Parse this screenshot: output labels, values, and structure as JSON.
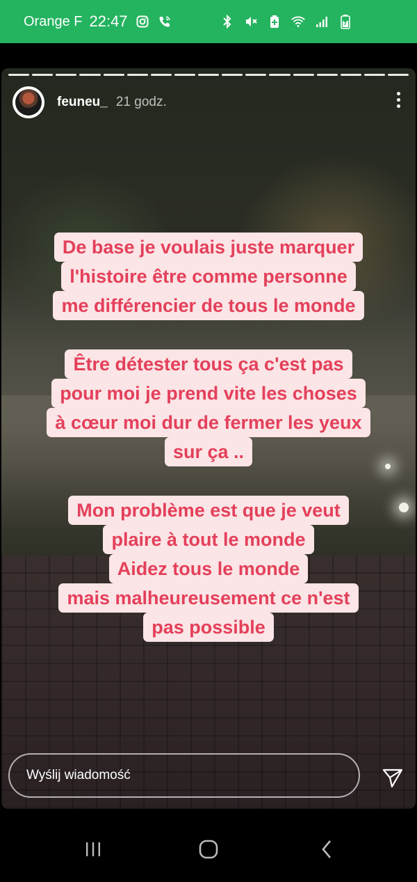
{
  "status_bar": {
    "carrier": "Orange F",
    "time": "22:47",
    "icons": [
      "instagram-icon",
      "wifi-call-icon",
      "bluetooth-icon",
      "mute-icon",
      "battery-saver-icon",
      "wifi-icon",
      "signal-icon",
      "battery-charging-icon"
    ],
    "background": "#24b35f"
  },
  "story": {
    "username": "feuneu_",
    "time_ago": "21 godz.",
    "progress_segments": 17,
    "captions": [
      {
        "lines": [
          "De base je voulais juste marquer",
          "l'histoire être comme personne",
          "me différencier de tous le monde"
        ]
      },
      {
        "lines": [
          "Être détester tous ça c'est pas",
          "pour moi je prend vite les choses",
          "à cœur moi dur de fermer les yeux",
          "sur ça .."
        ]
      },
      {
        "lines": [
          "Mon problème est que je veut",
          "plaire à tout le monde",
          "Aidez tous le monde",
          "mais malheureusement ce n'est",
          "pas possible"
        ]
      }
    ],
    "caption_color": "#e4405b",
    "caption_bg": "#fbe5e6"
  },
  "reply": {
    "placeholder": "Wyślij wiadomość"
  }
}
